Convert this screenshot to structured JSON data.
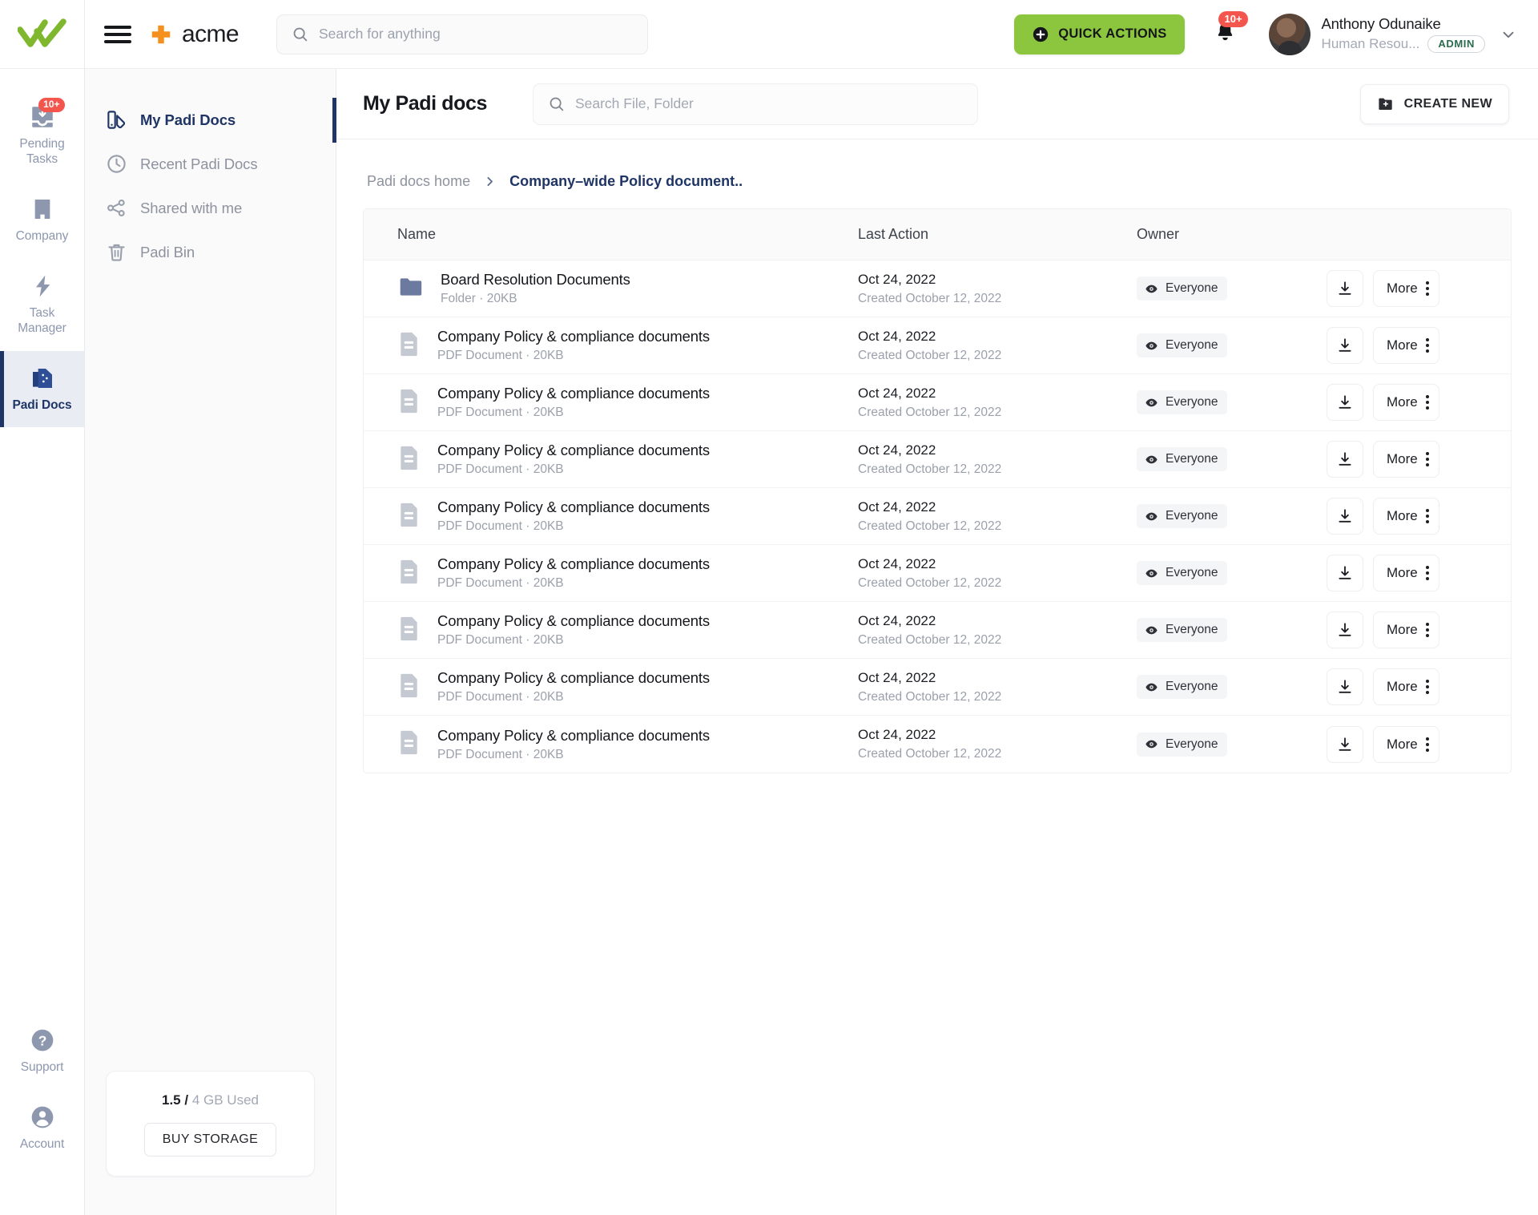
{
  "rail": {
    "logo_icon": "double-check-logo",
    "items": [
      {
        "label": "Pending\nTasks",
        "label_l1": "Pending",
        "label_l2": "Tasks",
        "icon": "inbox-download-icon",
        "badge": "10+",
        "active": false
      },
      {
        "label": "Company",
        "label_l1": "Company",
        "label_l2": "",
        "icon": "building-icon",
        "badge": "",
        "active": false
      },
      {
        "label": "Task Manager",
        "label_l1": "Task",
        "label_l2": "Manager",
        "icon": "lightning-bolt-icon",
        "badge": "",
        "active": false
      },
      {
        "label": "Padi Docs",
        "label_l1": "Padi Docs",
        "label_l2": "",
        "icon": "documents-stack-icon",
        "badge": "",
        "active": true
      }
    ],
    "bottom_items": [
      {
        "label": "Support",
        "icon": "question-circle-icon"
      },
      {
        "label": "Account",
        "icon": "user-circle-icon"
      }
    ]
  },
  "header": {
    "menu_icon": "hamburger-menu-icon",
    "brand": "acme",
    "brand_icon": "orange-cross-icon",
    "search": {
      "placeholder": "Search for anything",
      "value": "",
      "icon": "search-icon"
    },
    "quick_actions": {
      "label": "QUICK ACTIONS",
      "icon": "plus-circle-icon",
      "color": "#8cc63e"
    },
    "notifications": {
      "icon": "bell-icon",
      "badge": "10+",
      "badge_color": "#f4564e"
    },
    "user": {
      "name": "Anthony Odunaike",
      "role": "Human Resou...",
      "chip": "ADMIN",
      "avatar_icon": "user-avatar",
      "caret_icon": "chevron-down-icon"
    }
  },
  "sidebar": {
    "items": [
      {
        "label": "My Padi Docs",
        "icon": "padi-docs-icon",
        "active": true
      },
      {
        "label": "Recent Padi Docs",
        "icon": "clock-icon",
        "active": false
      },
      {
        "label": "Shared with me",
        "icon": "share-nodes-icon",
        "active": false
      },
      {
        "label": "Padi Bin",
        "icon": "trash-icon",
        "active": false
      }
    ],
    "storage": {
      "used": "1.5",
      "separator": "/",
      "total": "4 GB Used",
      "button": "BUY STORAGE"
    }
  },
  "main": {
    "title": "My Padi docs",
    "search": {
      "placeholder": "Search File, Folder",
      "value": "",
      "icon": "search-icon"
    },
    "create_new": {
      "label": "CREATE NEW",
      "icon": "folder-plus-icon"
    },
    "breadcrumb": {
      "home": "Padi docs home",
      "separator_icon": "chevron-right-icon",
      "current": "Company–wide Policy document.."
    },
    "table": {
      "columns": [
        "Name",
        "Last Action",
        "Owner",
        ""
      ],
      "row_actions": {
        "download_icon": "download-icon",
        "more_label": "More",
        "kebab_icon": "kebab-menu-icon"
      },
      "owner_icon": "eye-icon",
      "rows": [
        {
          "icon": "folder-icon",
          "name": "Board Resolution Documents",
          "meta": "Folder · 20KB",
          "last_action": "Oct 24, 2022",
          "created": "Created October 12, 2022",
          "owner": "Everyone"
        },
        {
          "icon": "pdf-file-icon",
          "name": "Company Policy & compliance documents",
          "meta": "PDF Document · 20KB",
          "last_action": "Oct 24, 2022",
          "created": "Created October 12, 2022",
          "owner": "Everyone"
        },
        {
          "icon": "pdf-file-icon",
          "name": "Company Policy & compliance documents",
          "meta": "PDF Document · 20KB",
          "last_action": "Oct 24, 2022",
          "created": "Created October 12, 2022",
          "owner": "Everyone"
        },
        {
          "icon": "pdf-file-icon",
          "name": "Company Policy & compliance documents",
          "meta": "PDF Document · 20KB",
          "last_action": "Oct 24, 2022",
          "created": "Created October 12, 2022",
          "owner": "Everyone"
        },
        {
          "icon": "pdf-file-icon",
          "name": "Company Policy & compliance documents",
          "meta": "PDF Document · 20KB",
          "last_action": "Oct 24, 2022",
          "created": "Created October 12, 2022",
          "owner": "Everyone"
        },
        {
          "icon": "pdf-file-icon",
          "name": "Company Policy & compliance documents",
          "meta": "PDF Document · 20KB",
          "last_action": "Oct 24, 2022",
          "created": "Created October 12, 2022",
          "owner": "Everyone"
        },
        {
          "icon": "pdf-file-icon",
          "name": "Company Policy & compliance documents",
          "meta": "PDF Document · 20KB",
          "last_action": "Oct 24, 2022",
          "created": "Created October 12, 2022",
          "owner": "Everyone"
        },
        {
          "icon": "pdf-file-icon",
          "name": "Company Policy & compliance documents",
          "meta": "PDF Document · 20KB",
          "last_action": "Oct 24, 2022",
          "created": "Created October 12, 2022",
          "owner": "Everyone"
        },
        {
          "icon": "pdf-file-icon",
          "name": "Company Policy & compliance documents",
          "meta": "PDF Document · 20KB",
          "last_action": "Oct 24, 2022",
          "created": "Created October 12, 2022",
          "owner": "Everyone"
        }
      ]
    }
  },
  "colors": {
    "accent_green": "#8cc63e",
    "brand_orange": "#f5901e",
    "navy": "#1f3566",
    "badge_red": "#f4564e"
  }
}
